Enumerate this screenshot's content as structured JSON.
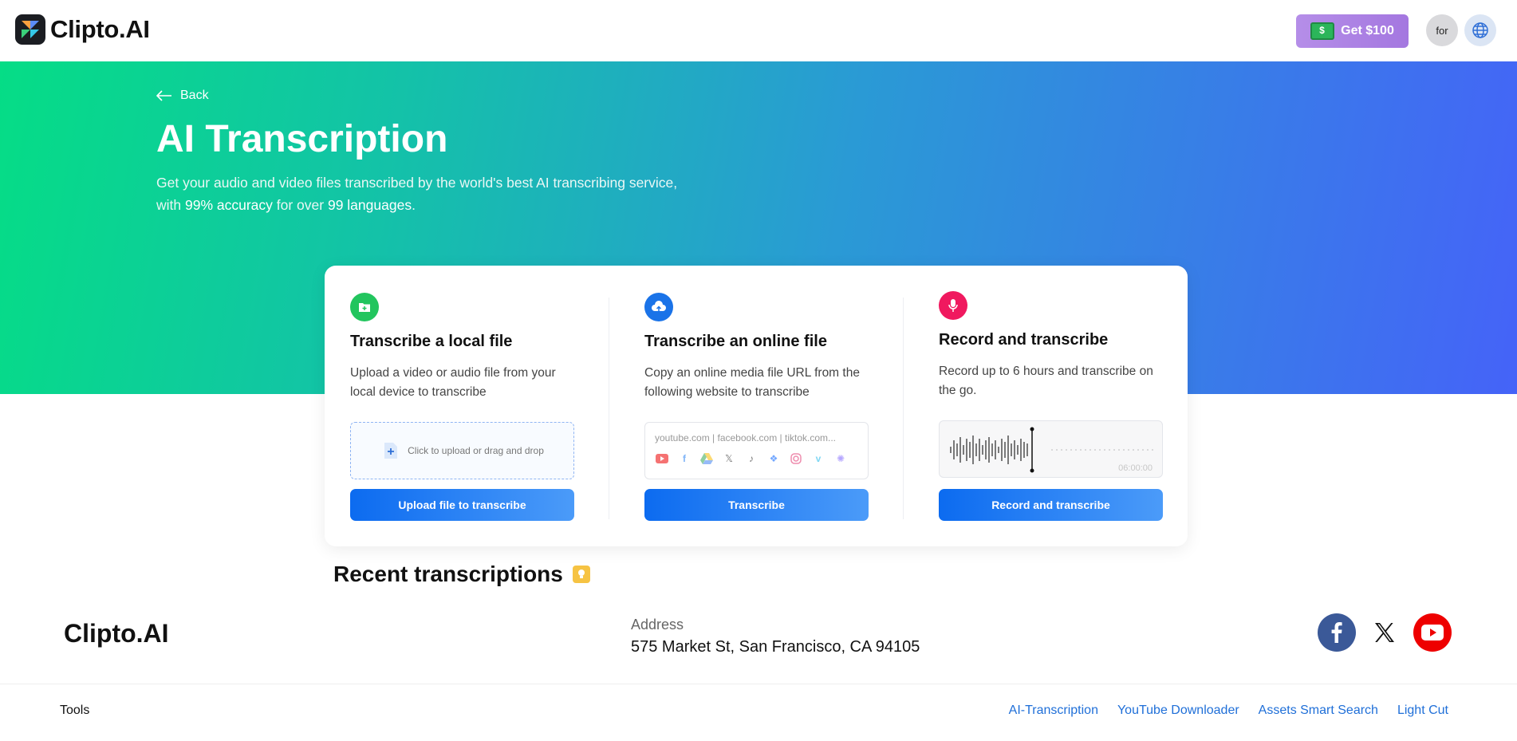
{
  "header": {
    "logo_text": "Clipto.AI",
    "promo_label": "Get $100",
    "lang_label": "for"
  },
  "hero": {
    "back_label": "Back",
    "title": "AI Transcription",
    "subtitle_line1": "Get your audio and video files transcribed by the world's best AI transcribing service,",
    "subtitle_with": "with ",
    "subtitle_accuracy": "99% accuracy",
    "subtitle_for": " for over ",
    "subtitle_languages": "99 languages",
    "subtitle_end": "."
  },
  "card": {
    "local": {
      "title": "Transcribe a local file",
      "desc": "Upload a video or audio file from your local device to transcribe",
      "dropzone_text": "Click to upload or drag and drop",
      "button": "Upload file to transcribe",
      "icon": "folder-plus-icon",
      "color": "#22c55e"
    },
    "online": {
      "title": "Transcribe an online file",
      "desc": "Copy an online media file URL from the following website to transcribe",
      "placeholder": "youtube.com | facebook.com | tiktok.com...",
      "platforms": [
        "youtube",
        "facebook",
        "google-drive",
        "x",
        "tiktok",
        "dropbox",
        "instagram",
        "vimeo",
        "other"
      ],
      "button": "Transcribe",
      "icon": "cloud-upload-icon",
      "color": "#1a73e8"
    },
    "record": {
      "title": "Record and transcribe",
      "desc": "Record up to 6 hours and transcribe on the go.",
      "time": "06:00:00",
      "button": "Record and transcribe",
      "icon": "microphone-icon",
      "color": "#f0195f"
    }
  },
  "recent": {
    "title": "Recent transcriptions"
  },
  "footer": {
    "logo_text": "Clipto.AI",
    "address_label": "Address",
    "address": "575 Market St, San Francisco, CA 94105",
    "tools_label": "Tools",
    "links": [
      "AI-Transcription",
      "YouTube Downloader",
      "Assets Smart Search",
      "Light Cut"
    ]
  }
}
